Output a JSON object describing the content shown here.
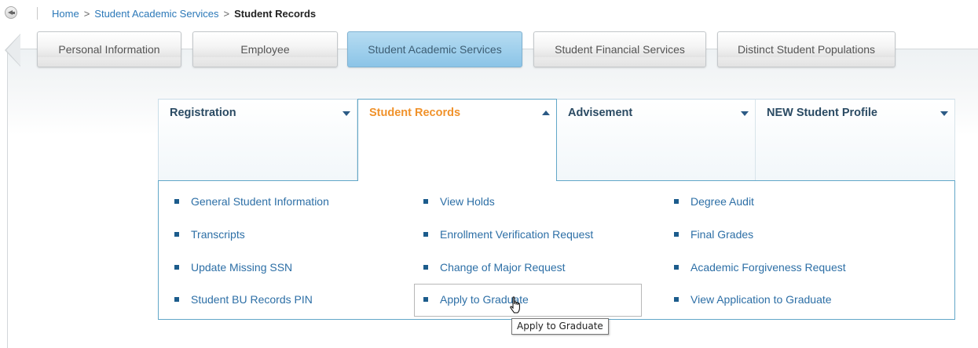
{
  "breadcrumb": {
    "home": "Home",
    "separator": ">",
    "section": "Student Academic Services",
    "current": "Student Records"
  },
  "tabs": [
    {
      "label": "Personal Information",
      "active": false
    },
    {
      "label": "Employee",
      "active": false
    },
    {
      "label": "Student Academic Services",
      "active": true
    },
    {
      "label": "Student Financial Services",
      "active": false
    },
    {
      "label": "Distinct Student Populations",
      "active": false
    }
  ],
  "menus": [
    {
      "label": "Registration",
      "expanded": false
    },
    {
      "label": "Student Records",
      "expanded": true
    },
    {
      "label": "Advisement",
      "expanded": false
    },
    {
      "label": "NEW Student Profile",
      "expanded": false
    }
  ],
  "dropdown": {
    "columns": [
      [
        "General Student Information",
        "Transcripts",
        "Update Missing SSN",
        "Student BU Records PIN"
      ],
      [
        "View Holds",
        "Enrollment Verification Request",
        "Change of Major Request",
        "Apply to Graduate"
      ],
      [
        "Degree Audit",
        "Final Grades",
        "Academic Forgiveness Request",
        "View Application to Graduate"
      ]
    ],
    "hovered_item": "Apply to Graduate"
  },
  "tooltip": "Apply to Graduate",
  "colors": {
    "link": "#2d6fa6",
    "active_menu": "#f0922b",
    "active_tab": "#9ecfec",
    "border_accent": "#62a7c8"
  }
}
